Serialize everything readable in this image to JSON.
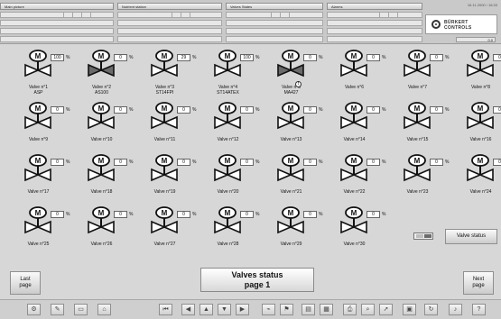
{
  "header": {
    "tabs": [
      "Main picture",
      "Nutrient station",
      "Valves States",
      "Alarms"
    ],
    "datetime": "16.11.2000 / 16:33",
    "logo_text": [
      "BÜRKERT",
      "CONTROLS"
    ],
    "status_value": "0.0"
  },
  "valves": [
    {
      "label": "Valve n°1\nASP",
      "value": "100",
      "dark": false,
      "warn": false
    },
    {
      "label": "Valve n°2\nAS100",
      "value": "0",
      "dark": true,
      "warn": false
    },
    {
      "label": "Valve n°3\nST14FPI",
      "value": "29",
      "dark": false,
      "warn": false
    },
    {
      "label": "Valve n°4\nST14ATEX",
      "value": "100",
      "dark": false,
      "warn": false
    },
    {
      "label": "Valve n°5\nMA427",
      "value": "0",
      "dark": true,
      "warn": true
    },
    {
      "label": "Valve n°6",
      "value": "0",
      "dark": false,
      "warn": false
    },
    {
      "label": "Valve n°7",
      "value": "0",
      "dark": false,
      "warn": false
    },
    {
      "label": "Valve n°8",
      "value": "0",
      "dark": false,
      "warn": false
    },
    {
      "label": "Valve n°9",
      "value": "0",
      "dark": false,
      "warn": false
    },
    {
      "label": "Valve n°10",
      "value": "0",
      "dark": false,
      "warn": false
    },
    {
      "label": "Valve n°11",
      "value": "0",
      "dark": false,
      "warn": false
    },
    {
      "label": "Valve n°12",
      "value": "0",
      "dark": false,
      "warn": false
    },
    {
      "label": "Valve n°13",
      "value": "0",
      "dark": false,
      "warn": false
    },
    {
      "label": "Valve n°14",
      "value": "0",
      "dark": false,
      "warn": false
    },
    {
      "label": "Valve n°15",
      "value": "0",
      "dark": false,
      "warn": false
    },
    {
      "label": "Valve n°16",
      "value": "0",
      "dark": false,
      "warn": false
    },
    {
      "label": "Valve n°17",
      "value": "0",
      "dark": false,
      "warn": false
    },
    {
      "label": "Valve n°18",
      "value": "0",
      "dark": false,
      "warn": false
    },
    {
      "label": "Valve n°19",
      "value": "0",
      "dark": false,
      "warn": false
    },
    {
      "label": "Valve n°20",
      "value": "0",
      "dark": false,
      "warn": false
    },
    {
      "label": "Valve n°21",
      "value": "0",
      "dark": false,
      "warn": false
    },
    {
      "label": "Valve n°22",
      "value": "0",
      "dark": false,
      "warn": false
    },
    {
      "label": "Valve n°23",
      "value": "0",
      "dark": false,
      "warn": false
    },
    {
      "label": "Valve n°24",
      "value": "0",
      "dark": false,
      "warn": false
    },
    {
      "label": "Valve n°25",
      "value": "0",
      "dark": false,
      "warn": false
    },
    {
      "label": "Valve n°26",
      "value": "0",
      "dark": false,
      "warn": false
    },
    {
      "label": "Valve n°27",
      "value": "0",
      "dark": false,
      "warn": false
    },
    {
      "label": "Valve n°28",
      "value": "0",
      "dark": false,
      "warn": false
    },
    {
      "label": "Valve n°29",
      "value": "0",
      "dark": false,
      "warn": false
    },
    {
      "label": "Valve n°30",
      "value": "0",
      "dark": false,
      "warn": false
    }
  ],
  "valve_unit": "%",
  "motor_letter": "M",
  "warning_symbol": "!",
  "status_button_label": "Valve status",
  "nav": {
    "last_page": "Last\npage",
    "next_page": "Next\npage"
  },
  "page_title": {
    "line1": "Valves status",
    "line2": "page 1"
  },
  "toolbar_icons": [
    "tool-icon-1",
    "tool-icon-2",
    "tool-icon-3",
    "tool-icon-4",
    "nav-first-icon",
    "nav-up-icon",
    "nav-home-icon",
    "nav-down-icon",
    "nav-right-icon",
    "view-icon-1",
    "view-icon-2",
    "tool-icon-5",
    "tool-icon-6",
    "print-icon",
    "zoom-icon",
    "pointer-icon",
    "save-icon",
    "reset-icon",
    "speaker-icon",
    "help-icon"
  ],
  "colors": {
    "valve_open": "#ffffff",
    "valve_closed": "#6a6a6a",
    "indicator_left": "#bfbfbf",
    "indicator_right": "#6b6b6b"
  }
}
